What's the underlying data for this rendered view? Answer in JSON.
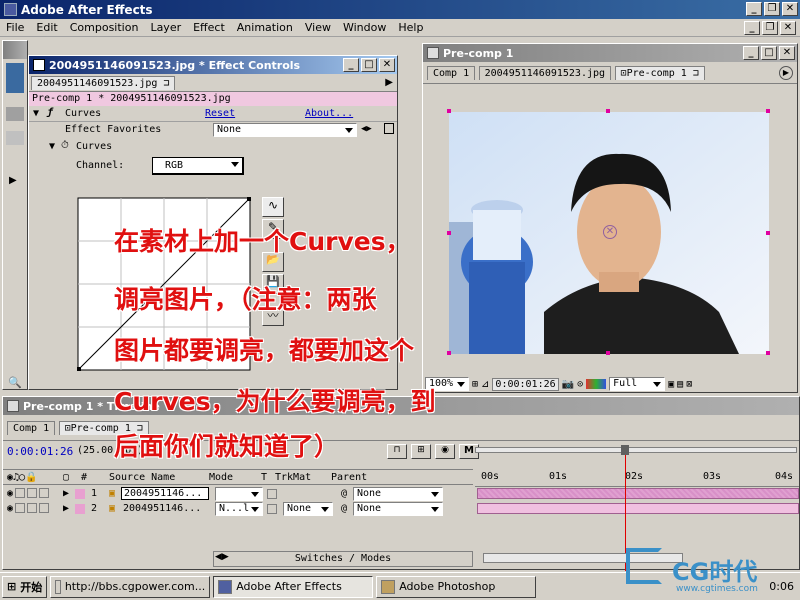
{
  "app": {
    "title": "Adobe After Effects"
  },
  "menu": [
    "File",
    "Edit",
    "Composition",
    "Layer",
    "Effect",
    "Animation",
    "View",
    "Window",
    "Help"
  ],
  "effect_controls": {
    "title": "2004951146091523.jpg * Effect Controls",
    "tab": "2004951146091523.jpg",
    "header": "Pre-comp 1 * 2004951146091523.jpg",
    "effect_name": "Curves",
    "reset": "Reset",
    "about": "About...",
    "favorites_label": "Effect Favorites",
    "favorites_value": "None",
    "curves_label": "Curves",
    "channel_label": "Channel:",
    "channel_value": "RGB"
  },
  "comp": {
    "title": "Pre-comp 1",
    "tabs": [
      "Comp 1",
      "2004951146091523.jpg",
      "Pre-comp 1"
    ],
    "zoom": "100%",
    "timecode": "0:00:01:26",
    "resolution": "Full"
  },
  "timeline": {
    "title": "Pre-comp 1 * Timeline",
    "tabs": [
      "Comp 1",
      "Pre-comp 1"
    ],
    "timecode": "0:00:01:26",
    "fps": "(25.00 fps)",
    "columns": {
      "num": "#",
      "source": "Source Name",
      "mode": "Mode",
      "t": "T",
      "trkmat": "TrkMat",
      "parent": "Parent"
    },
    "layers": [
      {
        "num": "1",
        "name": "2004951146...",
        "mode": "",
        "trkmat": "",
        "parent": "None"
      },
      {
        "num": "2",
        "name": "2004951146...",
        "mode": "N...l",
        "trkmat": "None",
        "parent": "None"
      }
    ],
    "ruler": [
      "00s",
      "01s",
      "02s",
      "03s",
      "04s"
    ],
    "footer": "Switches / Modes"
  },
  "overlay_text": [
    "在素材上加一个Curves，",
    "调亮图片，（注意：两张",
    "图片都要调亮，都要加这个",
    "Curves，为什么要调亮，到",
    "后面你们就知道了）"
  ],
  "taskbar": {
    "start": "开始",
    "items": [
      "http://bbs.cgpower.com...",
      "Adobe After Effects",
      "Adobe Photoshop"
    ],
    "time": "0:06"
  },
  "watermark": {
    "brand": "CG时代",
    "url": "www.cgtimes.com"
  }
}
